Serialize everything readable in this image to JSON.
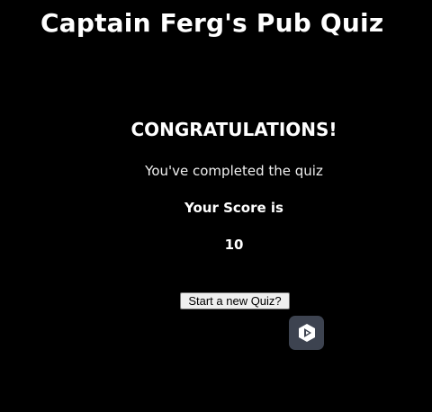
{
  "header": {
    "title": "Captain Ferg's Pub Quiz"
  },
  "results": {
    "heading": "CONGRATULATIONS!",
    "message": "You've completed the quiz",
    "score_label": "Your Score is",
    "score": "10"
  },
  "actions": {
    "restart_label": "Start a new Quiz?"
  },
  "widget": {
    "icon": "assistant-logo-icon",
    "background": "#3d4350"
  },
  "colors": {
    "background": "#000000",
    "text": "#ffffff"
  }
}
